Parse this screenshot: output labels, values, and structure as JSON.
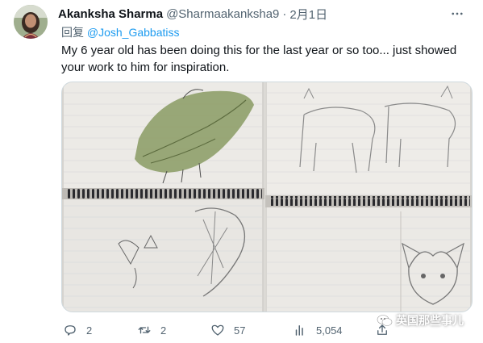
{
  "tweet": {
    "author_name": "Akanksha Sharma",
    "author_handle": "@Sharmaakanksha9",
    "separator": "·",
    "date": "2月1日",
    "reply_prefix": "回复 ",
    "reply_to": "@Josh_Gabbatiss",
    "text": "My 6 year old has been doing this for the last year or so too... just showed your work to him for inspiration.",
    "media_alt": "two photos of a child's sketchbook drawings"
  },
  "actions": {
    "replies": "2",
    "retweets": "2",
    "likes": "57",
    "views": "5,054"
  },
  "watermark": {
    "text": "英国那些事儿"
  },
  "colors": {
    "text_primary": "#0f1419",
    "text_secondary": "#536471",
    "link": "#1d9bf0",
    "border": "#cfd9de"
  }
}
